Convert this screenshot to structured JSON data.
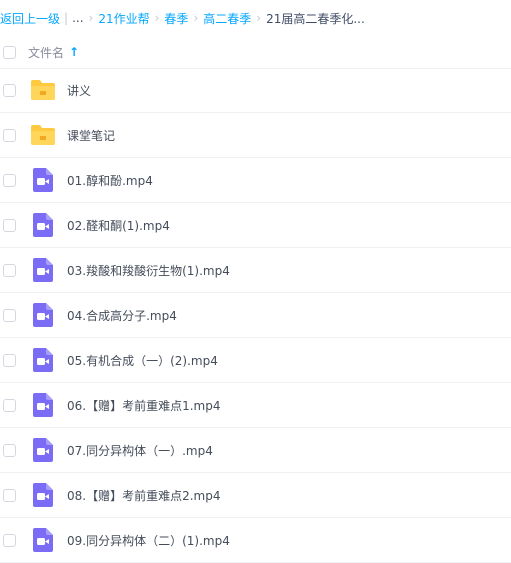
{
  "breadcrumb": {
    "back": "返回上一级",
    "ellipsis": "...",
    "items": [
      "21作业帮",
      "春季",
      "高二春季"
    ],
    "current": "21届高二春季化..."
  },
  "table_header": {
    "name_label": "文件名",
    "sort_icon": "arrow-up-icon"
  },
  "colors": {
    "accent": "#06a7ff",
    "folder": "#ffc940",
    "video": "#7b6cf6"
  },
  "files": [
    {
      "name": "讲义",
      "type": "folder",
      "icon": "folder-icon"
    },
    {
      "name": "课堂笔记",
      "type": "folder",
      "icon": "folder-icon"
    },
    {
      "name": "01.醇和酚.mp4",
      "type": "video",
      "icon": "video-file-icon"
    },
    {
      "name": "02.醛和酮(1).mp4",
      "type": "video",
      "icon": "video-file-icon"
    },
    {
      "name": "03.羧酸和羧酸衍生物(1).mp4",
      "type": "video",
      "icon": "video-file-icon"
    },
    {
      "name": "04.合成高分子.mp4",
      "type": "video",
      "icon": "video-file-icon"
    },
    {
      "name": "05.有机合成（一）(2).mp4",
      "type": "video",
      "icon": "video-file-icon"
    },
    {
      "name": "06.【赠】考前重难点1.mp4",
      "type": "video",
      "icon": "video-file-icon"
    },
    {
      "name": "07.同分异构体（一）.mp4",
      "type": "video",
      "icon": "video-file-icon"
    },
    {
      "name": "08.【赠】考前重难点2.mp4",
      "type": "video",
      "icon": "video-file-icon"
    },
    {
      "name": "09.同分异构体（二）(1).mp4",
      "type": "video",
      "icon": "video-file-icon"
    }
  ]
}
